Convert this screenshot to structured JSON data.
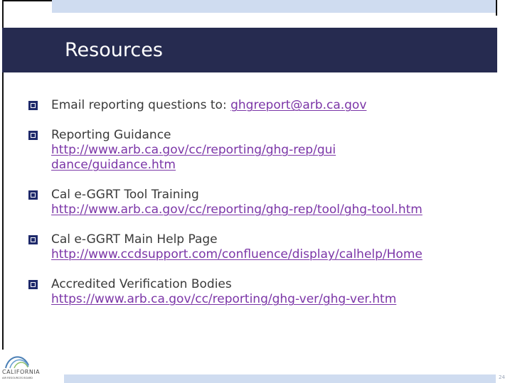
{
  "title": "Resources",
  "items": [
    {
      "label": "Email reporting questions to: ",
      "link": "ghgreport@arb.ca.gov"
    },
    {
      "label": "Reporting Guidance",
      "link": "http://www.arb.ca.gov/cc/reporting/ghg-rep/guidance/guidance.htm"
    },
    {
      "label": "Cal e-GGRT Tool Training",
      "link": "http://www.arb.ca.gov/cc/reporting/ghg-rep/tool/ghg-tool.htm"
    },
    {
      "label": "Cal e-GGRT Main Help Page",
      "link": "http://www.ccdsupport.com/confluence/display/calhelp/Home"
    },
    {
      "label": "Accredited Verification Bodies",
      "link": "https://www.arb.ca.gov/cc/reporting/ghg-ver/ghg-ver.htm"
    }
  ],
  "logo": {
    "name": "CALIFORNIA",
    "subtitle": "AIR RESOURCES BOARD",
    "icon": "california-air-resources-board-logo"
  },
  "slide_number": "24",
  "colors": {
    "title_bar": "#262b50",
    "band": "#cfdcf0",
    "bullet": "#1f2a6b",
    "link": "#7b35a7"
  }
}
